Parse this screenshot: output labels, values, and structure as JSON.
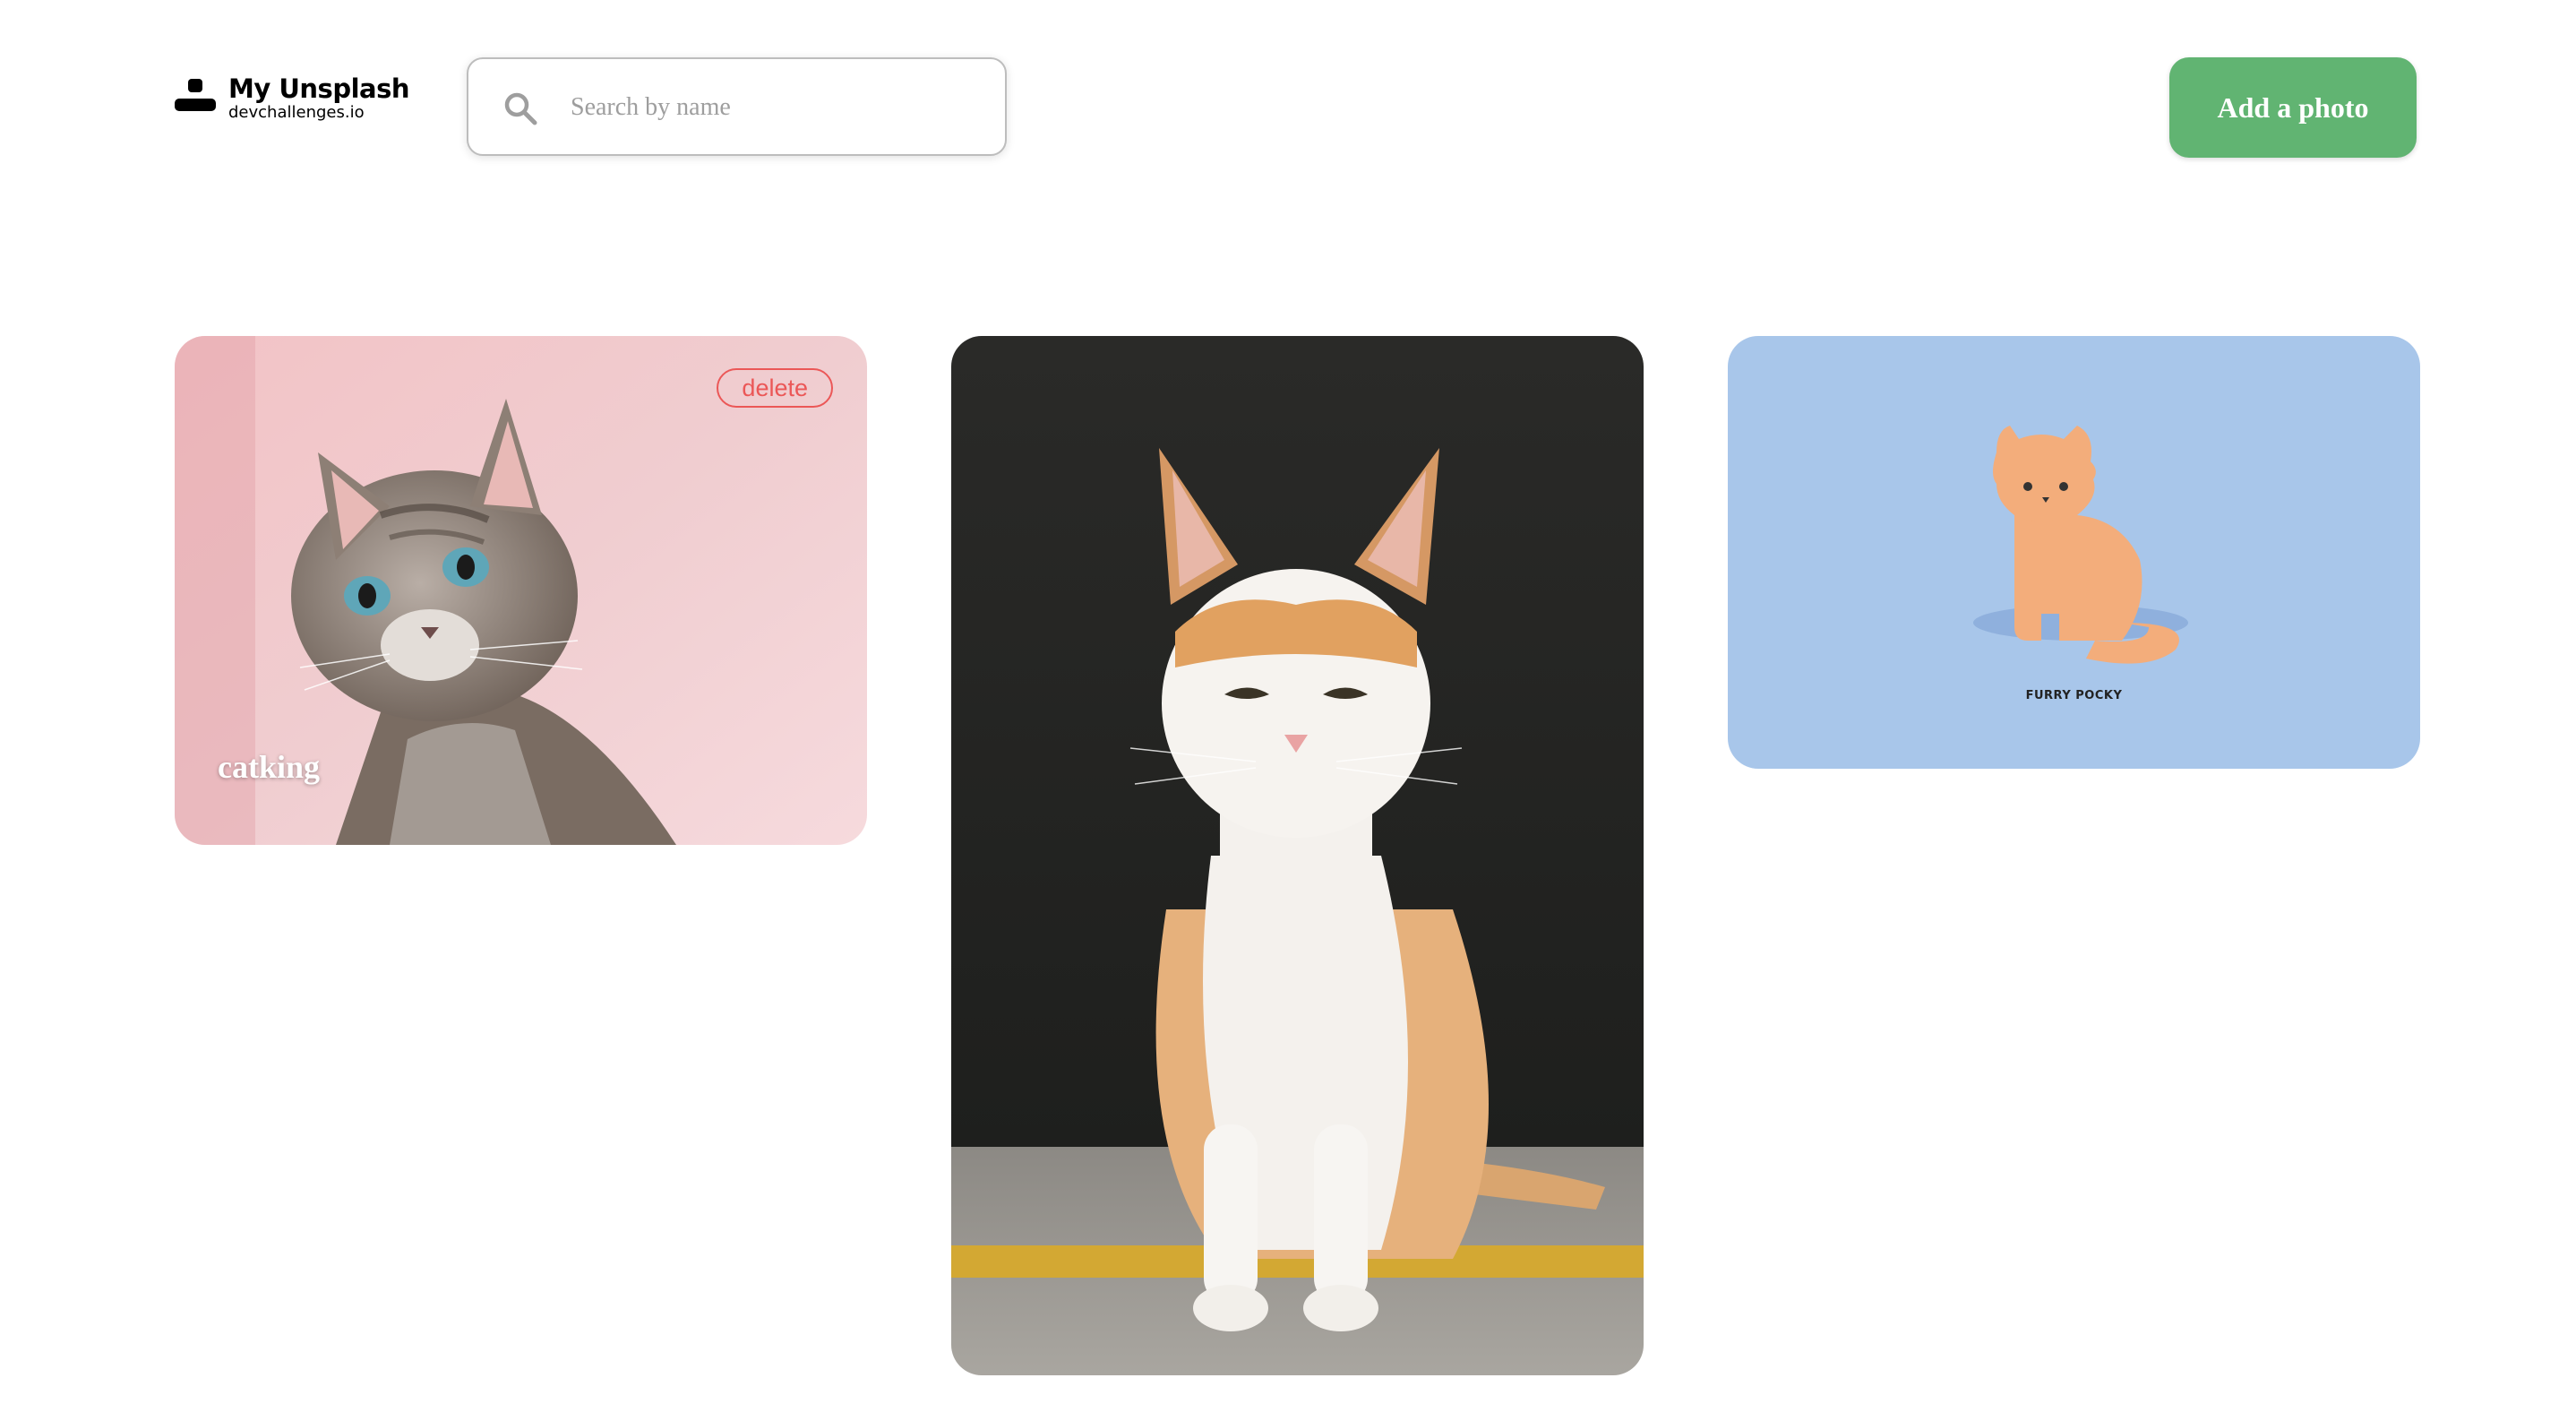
{
  "header": {
    "app_title": "My Unsplash",
    "app_subtitle": "devchallenges.io",
    "logo_icon": "user-icon",
    "search": {
      "placeholder": "Search by name",
      "value": "",
      "icon": "search-icon"
    },
    "add_button_label": "Add a photo"
  },
  "photos": [
    {
      "label": "catking",
      "delete_label": "delete",
      "subject": "kitten on pink background"
    },
    {
      "subject": "orange and white cat sitting"
    },
    {
      "subject": "cartoon cat illustration",
      "caption": "FURRY POCKY"
    }
  ],
  "colors": {
    "accent_green": "#61b472",
    "delete_red": "#eb5757",
    "card3_bg": "#a8c6ea"
  }
}
